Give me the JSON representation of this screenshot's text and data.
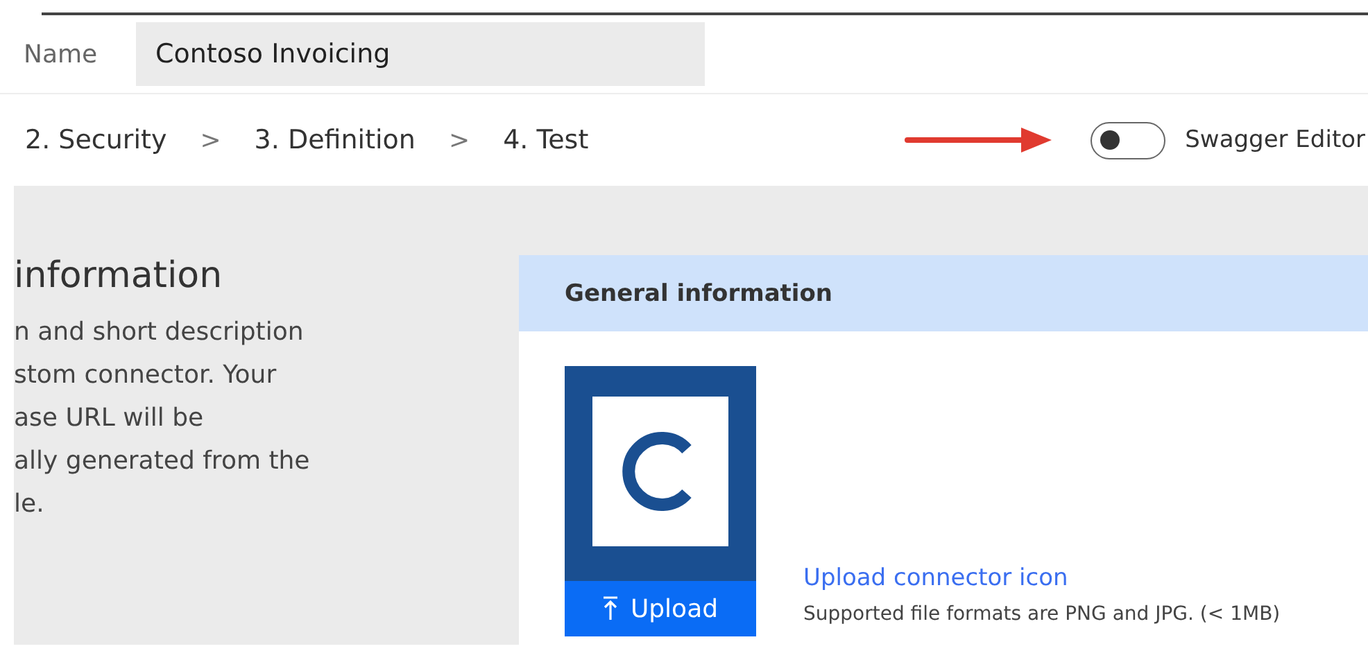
{
  "name_field": {
    "label": "Name",
    "value": "Contoso Invoicing"
  },
  "steps": [
    {
      "label": "2. Security",
      "selected": false
    },
    {
      "label": "3. Definition",
      "selected": false
    },
    {
      "label": "4. Test",
      "selected": false
    }
  ],
  "step_separator": ">",
  "swagger_toggle": {
    "label": "Swagger Editor",
    "on": false
  },
  "intro": {
    "heading": "information",
    "lines": [
      "n and short description",
      "stom connector. Your",
      "ase URL will be",
      "ally generated from the",
      "le."
    ]
  },
  "card": {
    "header": "General information",
    "upload_button": "Upload",
    "upload_link": "Upload connector icon",
    "upload_note": "Supported file formats are PNG and JPG. (< 1MB)"
  }
}
